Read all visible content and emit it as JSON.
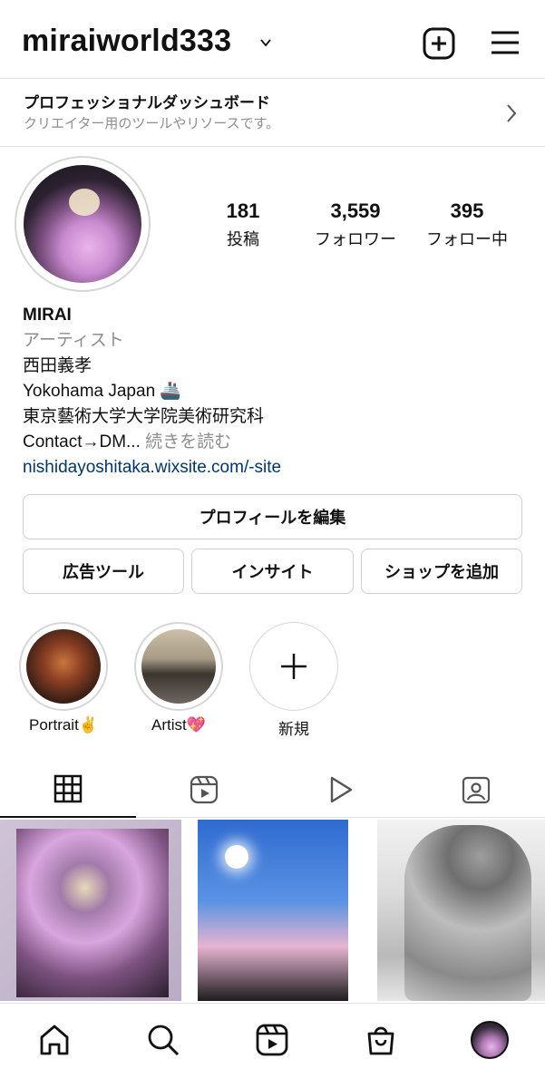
{
  "header": {
    "username": "miraiworld333"
  },
  "dashboard": {
    "title": "プロフェッショナルダッシュボード",
    "subtitle": "クリエイター用のツールやリソースです。"
  },
  "stats": [
    {
      "value": "181",
      "label": "投稿"
    },
    {
      "value": "3,559",
      "label": "フォロワー"
    },
    {
      "value": "395",
      "label": "フォロー中"
    }
  ],
  "bio": {
    "name": "MIRAI",
    "category": "アーティスト",
    "lines": [
      "西田義孝",
      "Yokohama Japan 🚢",
      "東京藝術大学大学院美術研究科"
    ],
    "contact": "Contact→DM...",
    "more": " 続きを読む",
    "link": "nishidayoshitaka.wixsite.com/-site"
  },
  "buttons": {
    "edit": "プロフィールを編集",
    "ad_tools": "広告ツール",
    "insights": "インサイト",
    "add_shop": "ショップを追加"
  },
  "highlights": [
    {
      "label": "Portrait✌️"
    },
    {
      "label": "Artist💖"
    },
    {
      "label": "新規"
    }
  ],
  "tabs": [
    {
      "icon": "grid-icon",
      "active": true
    },
    {
      "icon": "reels-icon",
      "active": false
    },
    {
      "icon": "play-icon",
      "active": false
    },
    {
      "icon": "tagged-icon",
      "active": false
    }
  ],
  "bottom_nav": [
    {
      "icon": "home-icon"
    },
    {
      "icon": "search-icon"
    },
    {
      "icon": "reels-icon"
    },
    {
      "icon": "shop-icon"
    },
    {
      "icon": "profile-avatar"
    }
  ]
}
